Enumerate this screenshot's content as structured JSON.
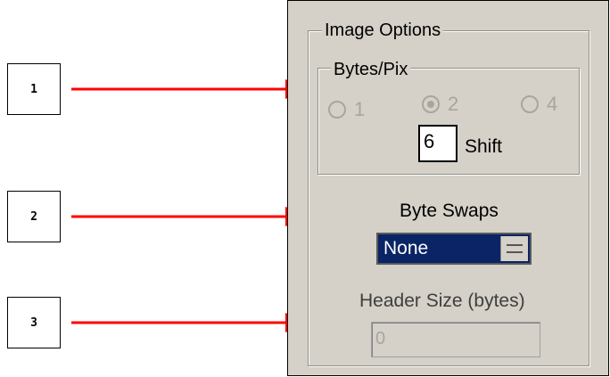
{
  "callouts": [
    "1",
    "2",
    "3"
  ],
  "image_options": {
    "title": "Image Options",
    "bytes_per_pixel": {
      "title": "Bytes/Pix",
      "options": [
        {
          "label": "1",
          "checked": false,
          "enabled": false
        },
        {
          "label": "2",
          "checked": true,
          "enabled": false
        },
        {
          "label": "4",
          "checked": false,
          "enabled": false
        }
      ],
      "shift_value": "6",
      "shift_label": "Shift"
    },
    "byte_swaps": {
      "label": "Byte Swaps",
      "selected": "None"
    },
    "header_size": {
      "label": "Header Size (bytes)",
      "value": "0",
      "enabled": false
    }
  },
  "colors": {
    "arrow": "#ff0000",
    "panel_bg": "#d5d1c8",
    "select_bg": "#0a2466",
    "disabled_text": "#a8a59d"
  }
}
